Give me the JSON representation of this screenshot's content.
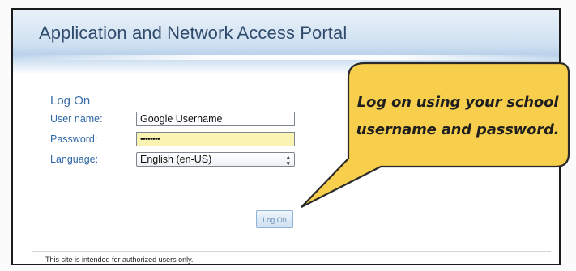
{
  "portal": {
    "title": "Application and Network Access Portal"
  },
  "login": {
    "heading": "Log On",
    "username_label": "User name:",
    "username_value": "Google Username",
    "password_label": "Password:",
    "password_value": "••••••••",
    "language_label": "Language:",
    "language_value": "English (en-US)",
    "submit_label": "Log On"
  },
  "footer": {
    "note": "This site is intended for authorized users only."
  },
  "callout": {
    "line1": "Log on using your school",
    "line2": "username and password."
  },
  "colors": {
    "title": "#2f4c6d",
    "labels": "#2f68a6",
    "callout_fill": "#f7cf4d",
    "password_fill": "#fbf3b2"
  },
  "icons": {
    "select_arrows": "chevron-up-down-icon"
  }
}
